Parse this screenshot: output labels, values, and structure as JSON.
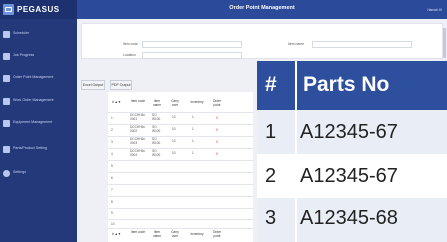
{
  "sidebar": {
    "logo_text": "PEGASUS",
    "items": [
      {
        "label": "Scheduler",
        "icon": "user-icon"
      },
      {
        "label": "Job Progress",
        "icon": "document-icon"
      },
      {
        "label": "Order Point Management",
        "icon": "orders-icon"
      },
      {
        "label": "Work Order Management",
        "icon": "work-icon"
      },
      {
        "label": "Equipment Management",
        "icon": "equipment-icon"
      },
      {
        "label": "Parts/Product Setting",
        "icon": "settings-icon"
      },
      {
        "label": "Settings",
        "icon": "gear-icon"
      }
    ]
  },
  "header": {
    "title": "Order Point Management",
    "user": "Hanuch Ki"
  },
  "search": {
    "item_code_label": "Item code",
    "item_name_label": "Item name",
    "location_label": "Location"
  },
  "buttons": {
    "excel_output": "Excel Output",
    "pdf_output": "PDF Output"
  },
  "table": {
    "headers": [
      "# ▲▼",
      "Item code",
      "Item name",
      "Carry over",
      "Inventory",
      "Order point"
    ],
    "rows": [
      {
        "num": "1",
        "code": "DCCHH4n 0001",
        "name": "SO W100",
        "carry": "10",
        "inv": "1",
        "order": "0"
      },
      {
        "num": "2",
        "code": "DCCHH4n 0002",
        "name": "SO W100",
        "carry": "10",
        "inv": "1",
        "order": "0"
      },
      {
        "num": "3",
        "code": "DCCHH4n 0003",
        "name": "SO W100",
        "carry": "10",
        "inv": "1",
        "order": "0"
      },
      {
        "num": "4",
        "code": "DCCHH4n 0004",
        "name": "SO W100",
        "carry": "10",
        "inv": "1",
        "order": "0"
      }
    ],
    "empty_rows": [
      "5",
      "6",
      "7",
      "8",
      "9",
      "10"
    ]
  },
  "zoom": {
    "header_hash": "#",
    "header_parts": "Parts No",
    "rows": [
      {
        "num": "1",
        "part": "A12345-67"
      },
      {
        "num": "2",
        "part": "A12345-67"
      },
      {
        "num": "3",
        "part": "A12345-68"
      }
    ]
  },
  "colors": {
    "sidebar": "#24397a",
    "header": "#2b4a9a",
    "zoom_header": "#2e4f9e",
    "accent_red": "#dd2222"
  }
}
